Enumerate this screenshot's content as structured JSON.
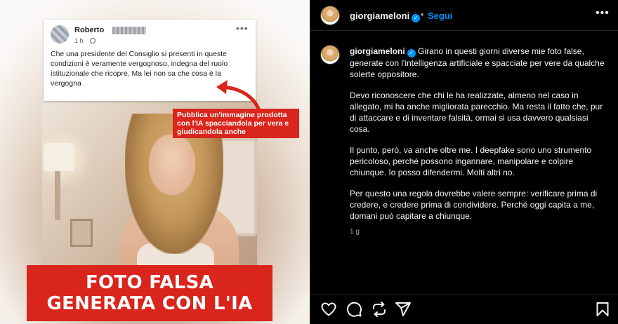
{
  "left_post": {
    "fb_card": {
      "author_first_name": "Roberto",
      "time": "1 h ·",
      "text": "Che una presidente del Consiglio  si presenti in queste condizioni è veramente vergognoso, indegna del ruolo istituzionale che ricopre. Ma lei non sa che cosa è la vergogna"
    },
    "red_note": "Pubblica un'immagine prodotta con l'IA spacciandola per vera e giudicandola anche",
    "banner": {
      "line1": "FOTO FALSA",
      "line2": "GENERATA CON L'IA"
    }
  },
  "instagram": {
    "header": {
      "username": "giorgiameloni",
      "follow_label": "Segui"
    },
    "caption": {
      "username": "giorgiameloni",
      "paragraph1": "Girano in questi giorni diverse mie foto false, generate con l'intelligenza artificiale e spacciate per vere da qualche solerte oppositore.",
      "paragraph2": "Devo riconoscere che chi le ha realizzate, almeno nel caso in allegato, mi ha anche migliorata parecchio. Ma resta il fatto che, pur di attaccare e di inventare falsità, ormai si usa davvero qualsiasi cosa.",
      "paragraph3": "Il punto, però, va anche oltre me. I deepfake sono uno strumento pericoloso, perché possono ingannare, manipolare e colpire chiunque. Io posso difendermi. Molti altri no.",
      "paragraph4": "Per questo una regola dovrebbe valere sempre: verificare prima di credere, e credere prima di condividere. Perché oggi capita a me, domani può capitare a chiunque.",
      "age": "1 g"
    },
    "colors": {
      "background": "#000000",
      "link_blue": "#0095f6",
      "text": "#f5f5f5",
      "muted": "#a8a8a8"
    },
    "actions": [
      "heart-icon",
      "comment-icon",
      "repost-icon",
      "share-icon",
      "bookmark-icon"
    ]
  },
  "accent_red": "#d9251c"
}
